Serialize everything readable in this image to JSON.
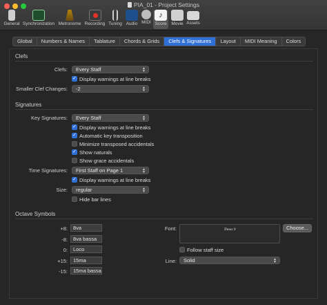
{
  "window": {
    "title": "PIA_01 - Project Settings"
  },
  "toolbar": {
    "items": [
      {
        "label": "General",
        "icon": "switch-icon"
      },
      {
        "label": "Synchronization",
        "icon": "sync-waveform-icon"
      },
      {
        "label": "Metronome",
        "icon": "metronome-icon"
      },
      {
        "label": "Recording",
        "icon": "record-icon"
      },
      {
        "label": "Tuning",
        "icon": "tuning-fork-icon"
      },
      {
        "label": "Audio",
        "icon": "audio-waveform-icon"
      },
      {
        "label": "MIDI",
        "icon": "midi-port-icon"
      },
      {
        "label": "Score",
        "icon": "music-note-icon"
      },
      {
        "label": "Movie",
        "icon": "film-icon"
      },
      {
        "label": "Assets",
        "icon": "briefcase-icon"
      }
    ]
  },
  "tabs": [
    "Global",
    "Numbers & Names",
    "Tablature",
    "Chords & Grids",
    "Clefs & Signatures",
    "Layout",
    "MIDI Meaning",
    "Colors"
  ],
  "clefs": {
    "section": "Clefs",
    "clefs_label": "Clefs:",
    "clefs_value": "Every Staff",
    "display_warnings": "Display warnings at line breaks",
    "smaller_label": "Smaller Clef Changes:",
    "smaller_value": "-2"
  },
  "signatures": {
    "section": "Signatures",
    "key_label": "Key Signatures:",
    "key_value": "Every Staff",
    "key_warnings": "Display warnings at line breaks",
    "auto_transposition": "Automatic key transposition",
    "minimize": "Minimize transposed accidentals",
    "show_naturals": "Show naturals",
    "show_grace": "Show grace accidentals",
    "time_label": "Time Signatures:",
    "time_value": "First Staff on Page 1",
    "time_warnings": "Display warnings at line breaks",
    "size_label": "Size:",
    "size_value": "regular",
    "hide_bar": "Hide bar lines"
  },
  "octave": {
    "section": "Octave Symbols",
    "rows": [
      {
        "label": "+8:",
        "value": "8va"
      },
      {
        "label": "-8:",
        "value": "8va bassa"
      },
      {
        "label": "0:",
        "value": "Loco"
      },
      {
        "label": "+15:",
        "value": "15ma"
      },
      {
        "label": "-15:",
        "value": "15ma bassa"
      }
    ],
    "font_label": "Font:",
    "font_preview": "Times 9",
    "choose_button": "Choose...",
    "follow_staff": "Follow staff size",
    "line_label": "Line:",
    "line_value": "Solid"
  },
  "colors": {
    "accent": "#2f6fd6",
    "background": "#262626"
  }
}
